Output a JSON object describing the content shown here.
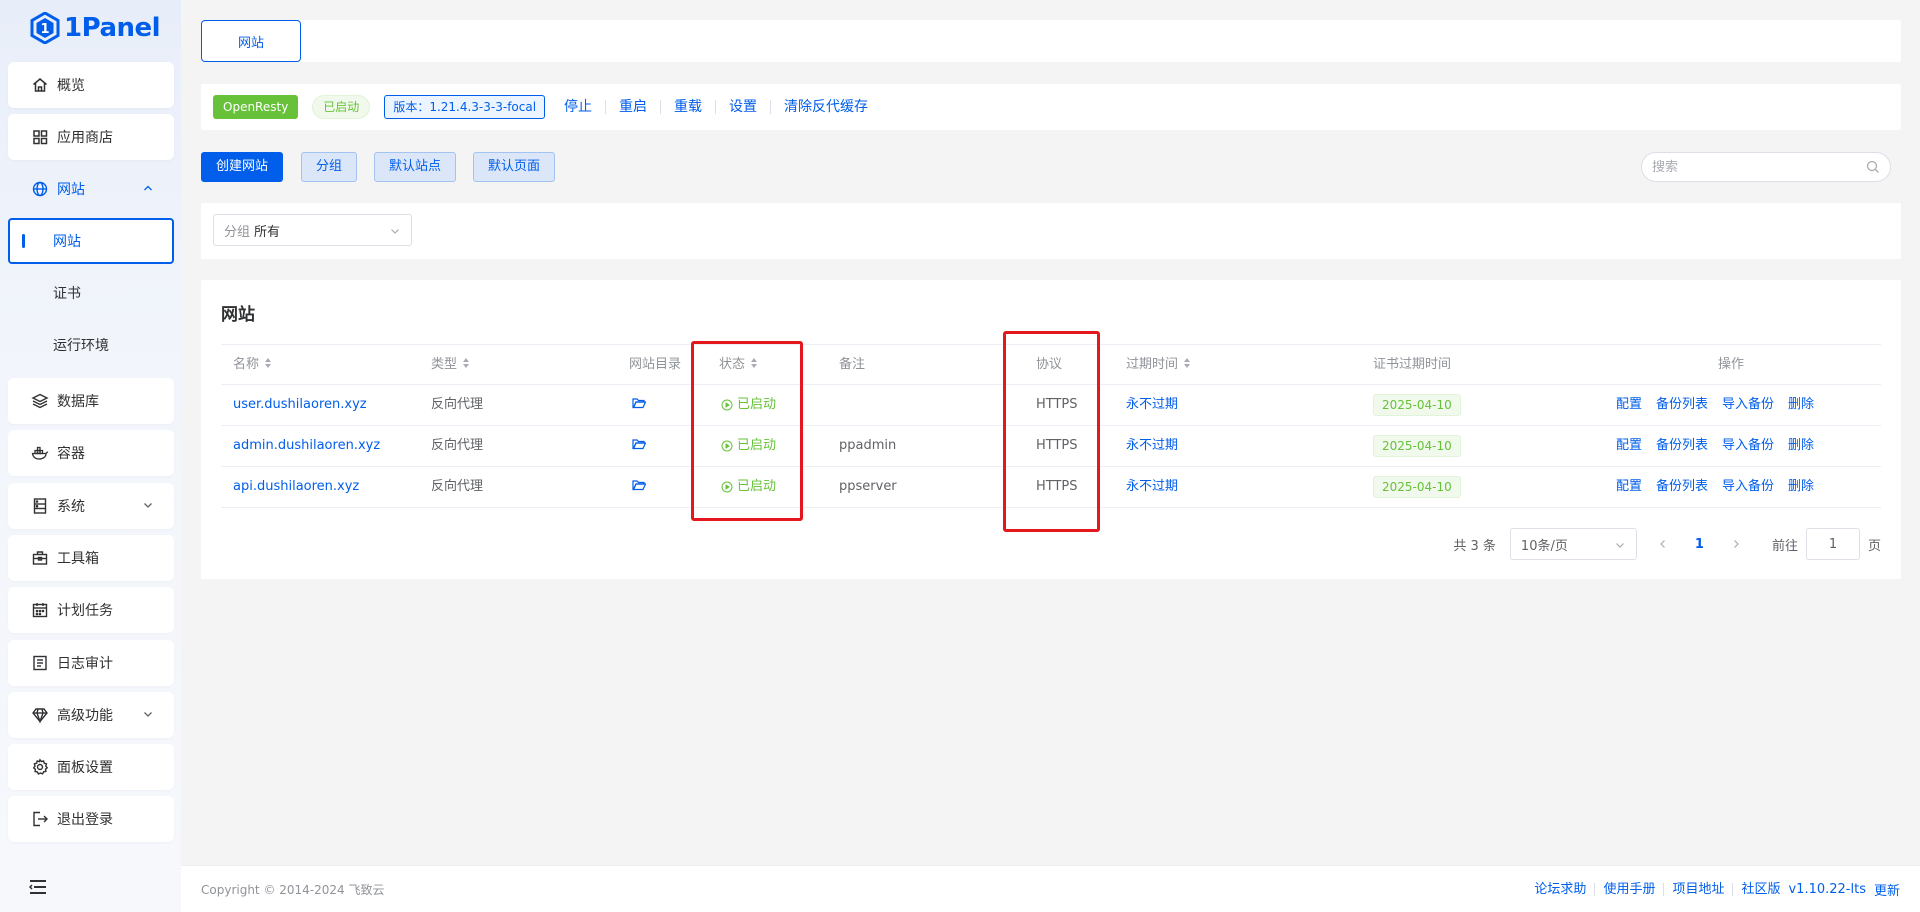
{
  "brand": {
    "name": "1Panel",
    "color": "#005eeb"
  },
  "sidebar": {
    "items": [
      {
        "label": "概览",
        "icon": "home-icon"
      },
      {
        "label": "应用商店",
        "icon": "grid-icon"
      },
      {
        "label": "网站",
        "icon": "globe-icon",
        "expanded": true,
        "children": [
          {
            "label": "网站",
            "active": true
          },
          {
            "label": "证书"
          },
          {
            "label": "运行环境"
          }
        ]
      },
      {
        "label": "数据库",
        "icon": "layers-icon"
      },
      {
        "label": "容器",
        "icon": "docker-icon"
      },
      {
        "label": "系统",
        "icon": "server-icon",
        "has_children": true
      },
      {
        "label": "工具箱",
        "icon": "toolbox-icon"
      },
      {
        "label": "计划任务",
        "icon": "calendar-icon"
      },
      {
        "label": "日志审计",
        "icon": "log-icon"
      },
      {
        "label": "高级功能",
        "icon": "diamond-icon",
        "has_children": true
      },
      {
        "label": "面板设置",
        "icon": "gear-icon"
      },
      {
        "label": "退出登录",
        "icon": "logout-icon"
      }
    ]
  },
  "tabs": [
    {
      "label": "网站",
      "active": true
    }
  ],
  "status_bar": {
    "app": "OpenResty",
    "state": "已启动",
    "version": "版本：1.21.4.3-3-3-focal",
    "actions": [
      "停止",
      "重启",
      "重载",
      "设置",
      "清除反代缓存"
    ]
  },
  "toolbar": {
    "create": "创建网站",
    "group": "分组",
    "default_site": "默认站点",
    "default_page": "默认页面",
    "search_placeholder": "搜索"
  },
  "filter": {
    "prefix": "分组",
    "value": "所有"
  },
  "table": {
    "title": "网站",
    "columns": {
      "name": "名称",
      "type": "类型",
      "dir": "网站目录",
      "status": "状态",
      "remark": "备注",
      "protocol": "协议",
      "expire": "过期时间",
      "cert_expire": "证书过期时间",
      "ops": "操作"
    },
    "rows": [
      {
        "name": "user.dushilaoren.xyz",
        "type": "反向代理",
        "status": "已启动",
        "remark": "",
        "protocol": "HTTPS",
        "expire": "永不过期",
        "cert_expire": "2025-04-10"
      },
      {
        "name": "admin.dushilaoren.xyz",
        "type": "反向代理",
        "status": "已启动",
        "remark": "ppadmin",
        "protocol": "HTTPS",
        "expire": "永不过期",
        "cert_expire": "2025-04-10"
      },
      {
        "name": "api.dushilaoren.xyz",
        "type": "反向代理",
        "status": "已启动",
        "remark": "ppserver",
        "protocol": "HTTPS",
        "expire": "永不过期",
        "cert_expire": "2025-04-10"
      }
    ],
    "ops": [
      "配置",
      "备份列表",
      "导入备份",
      "删除"
    ]
  },
  "pagination": {
    "total": "共 3 条",
    "page_size": "10条/页",
    "current": "1",
    "goto_label": "前往",
    "goto_value": "1",
    "page_unit": "页"
  },
  "footer": {
    "copyright": "Copyright © 2014-2024 飞致云",
    "links": [
      "论坛求助",
      "使用手册",
      "项目地址",
      "社区版"
    ],
    "version": "v1.10.22-lts",
    "update": "更新"
  },
  "colors": {
    "primary": "#005eeb",
    "success": "#67c23a",
    "highlight": "#e3171c"
  }
}
